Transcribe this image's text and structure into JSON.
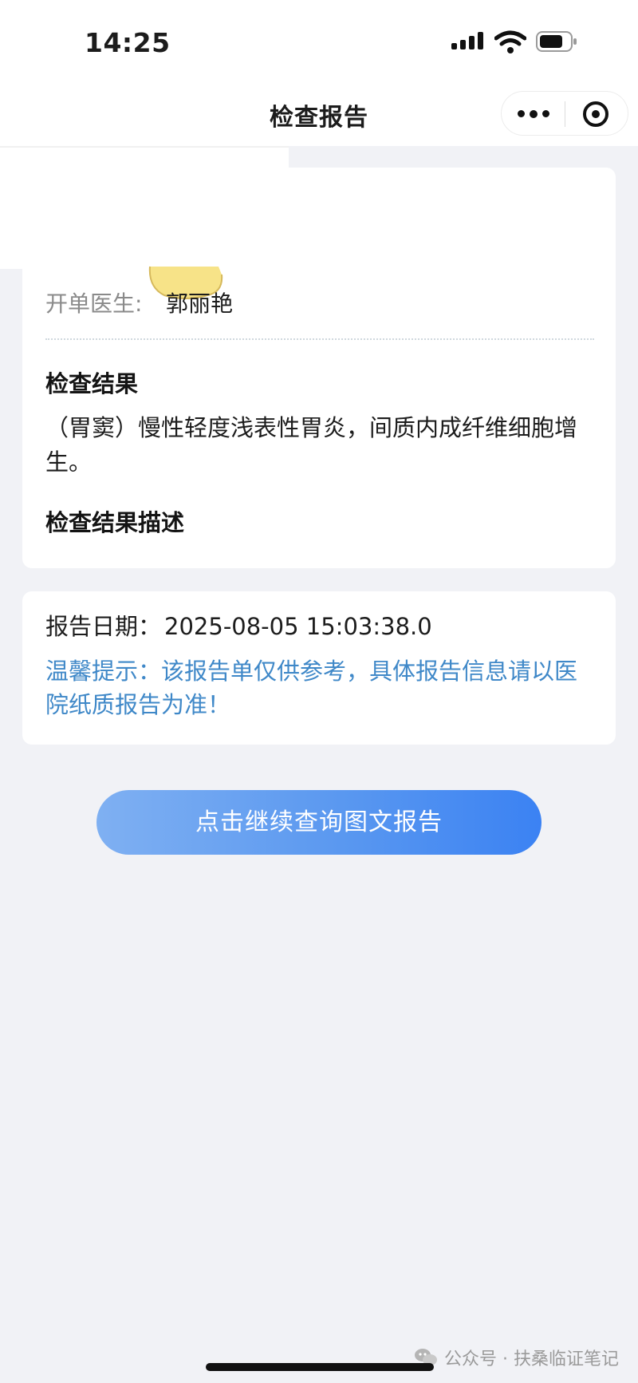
{
  "status_bar": {
    "time": "14:25",
    "icons": [
      "signal-icon",
      "wifi-icon",
      "battery-icon"
    ]
  },
  "nav": {
    "title": "检查报告",
    "more_icon": "more-dots-icon",
    "close_icon": "target-circle-icon"
  },
  "report": {
    "doctor_label": "开单医生:",
    "doctor_value": "郭丽艳",
    "result_heading": "检查结果",
    "result_text": "（胃窦）慢性轻度浅表性胃炎，间质内成纤维细胞增生。",
    "description_heading": "检查结果描述"
  },
  "date_card": {
    "date_label": "报告日期：",
    "date_value": "2025-08-05 15:03:38.0",
    "tip": "温馨提示：该报告单仅供参考，具体报告信息请以医院纸质报告为准！"
  },
  "actions": {
    "continue_button": "点击继续查询图文报告"
  },
  "watermark": {
    "text": "公众号 · 扶桑临证笔记",
    "icon": "wechat-icon"
  },
  "colors": {
    "background": "#f1f2f6",
    "tip_text": "#3f88c8",
    "button_gradient_start": "#7fb0f2",
    "button_gradient_end": "#3b82f3"
  }
}
